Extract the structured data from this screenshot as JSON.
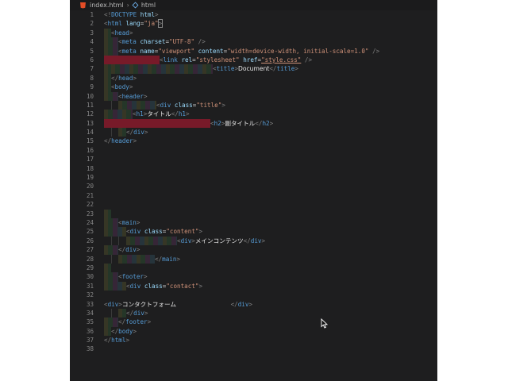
{
  "breadcrumb": {
    "file": "index.html",
    "symbol": "html"
  },
  "lines": [
    {
      "n": "1",
      "guides": [],
      "tok": [
        [
          "b",
          "<!"
        ],
        [
          "t",
          "DOCTYPE"
        ],
        [
          "a",
          " html"
        ],
        [
          "b",
          ">"
        ]
      ]
    },
    {
      "n": "2",
      "guides": [],
      "tok": [
        [
          "b",
          "<"
        ],
        [
          "t",
          "html"
        ],
        [
          "a",
          " lang"
        ],
        [
          "p",
          "="
        ],
        [
          "s",
          "\"ja\""
        ],
        [
          "b",
          ">"
        ]
      ]
    },
    {
      "n": "3",
      "guides": [],
      "tok": [
        [
          "b",
          "<"
        ],
        [
          "t",
          "head"
        ],
        [
          "b",
          ">"
        ]
      ]
    },
    {
      "n": "4",
      "guides": [],
      "tok": [
        [
          "b",
          "<"
        ],
        [
          "t",
          "meta"
        ],
        [
          "a",
          " charset"
        ],
        [
          "p",
          "="
        ],
        [
          "s",
          "\"UTF-8\""
        ],
        [
          "b",
          " />"
        ]
      ]
    },
    {
      "n": "5",
      "guides": [],
      "tok": [
        [
          "b",
          "<"
        ],
        [
          "t",
          "meta"
        ],
        [
          "a",
          " name"
        ],
        [
          "p",
          "="
        ],
        [
          "s",
          "\"viewport\""
        ],
        [
          "a",
          " content"
        ],
        [
          "p",
          "="
        ],
        [
          "s",
          "\"width=device-width, initial-scale=1.0\""
        ],
        [
          "b",
          " />"
        ]
      ]
    },
    {
      "n": "6",
      "guides": [],
      "tok": [
        [
          "b",
          "<"
        ],
        [
          "t",
          "link"
        ],
        [
          "a",
          " rel"
        ],
        [
          "p",
          "="
        ],
        [
          "s",
          "\"stylesheet\""
        ],
        [
          "a",
          " href"
        ],
        [
          "p",
          "="
        ],
        [
          "su",
          "\"style.css\""
        ],
        [
          "b",
          " />"
        ]
      ]
    },
    {
      "n": "7",
      "guides": [],
      "tok": [
        [
          "b",
          "<"
        ],
        [
          "t",
          "title"
        ],
        [
          "b",
          ">"
        ],
        [
          "x",
          "Document"
        ],
        [
          "b",
          "</"
        ],
        [
          "t",
          "title"
        ],
        [
          "b",
          ">"
        ]
      ]
    },
    {
      "n": "8",
      "guides": [],
      "tok": [
        [
          "b",
          "</"
        ],
        [
          "t",
          "head"
        ],
        [
          "b",
          ">"
        ]
      ]
    },
    {
      "n": "9",
      "guides": [],
      "tok": [
        [
          "b",
          "<"
        ],
        [
          "t",
          "body"
        ],
        [
          "b",
          ">"
        ]
      ]
    },
    {
      "n": "10",
      "guides": [],
      "tok": [
        [
          "b",
          "<"
        ],
        [
          "t",
          "header"
        ],
        [
          "b",
          ">"
        ]
      ]
    },
    {
      "n": "11",
      "guides": [],
      "tok": [
        [
          "b",
          "<"
        ],
        [
          "t",
          "div"
        ],
        [
          "a",
          " class"
        ],
        [
          "p",
          "="
        ],
        [
          "s",
          "\"title\""
        ],
        [
          "b",
          ">"
        ]
      ]
    },
    {
      "n": "12",
      "guides": [],
      "tok": [
        [
          "b",
          "<"
        ],
        [
          "t",
          "h1"
        ],
        [
          "b",
          ">"
        ],
        [
          "x",
          "タイトル"
        ],
        [
          "b",
          "</"
        ],
        [
          "t",
          "h1"
        ],
        [
          "b",
          ">"
        ]
      ]
    },
    {
      "n": "13",
      "guides": [],
      "tok": [
        [
          "b",
          "<"
        ],
        [
          "t",
          "h2"
        ],
        [
          "b",
          ">"
        ],
        [
          "x",
          "副タイトル"
        ],
        [
          "b",
          "</"
        ],
        [
          "t",
          "h2"
        ],
        [
          "b",
          ">"
        ]
      ]
    },
    {
      "n": "14",
      "guides": [],
      "tok": [
        [
          "b",
          "</"
        ],
        [
          "t",
          "div"
        ],
        [
          "b",
          ">"
        ]
      ]
    },
    {
      "n": "15",
      "guides": [],
      "tok": [
        [
          "b",
          "</"
        ],
        [
          "t",
          "header"
        ],
        [
          "b",
          ">"
        ]
      ]
    },
    {
      "n": "16",
      "guides": [],
      "tok": []
    },
    {
      "n": "17",
      "guides": [],
      "tok": []
    },
    {
      "n": "18",
      "guides": [],
      "tok": []
    },
    {
      "n": "19",
      "guides": [],
      "tok": []
    },
    {
      "n": "20",
      "guides": [],
      "tok": []
    },
    {
      "n": "21",
      "guides": [],
      "tok": []
    },
    {
      "n": "22",
      "guides": [],
      "tok": []
    },
    {
      "n": "23",
      "guides": [],
      "tok": []
    },
    {
      "n": "24",
      "guides": [],
      "tok": [
        [
          "b",
          "<"
        ],
        [
          "t",
          "main"
        ],
        [
          "b",
          ">"
        ]
      ]
    },
    {
      "n": "25",
      "guides": [],
      "tok": [
        [
          "b",
          "<"
        ],
        [
          "t",
          "div"
        ],
        [
          "a",
          " class"
        ],
        [
          "p",
          "="
        ],
        [
          "s",
          "\"content\""
        ],
        [
          "b",
          ">"
        ]
      ]
    },
    {
      "n": "26",
      "guides": [],
      "tok": [
        [
          "b",
          "<"
        ],
        [
          "t",
          "div"
        ],
        [
          "b",
          ">"
        ],
        [
          "x",
          "メインコンテンツ"
        ],
        [
          "b",
          "</"
        ],
        [
          "t",
          "div"
        ],
        [
          "b",
          ">"
        ]
      ]
    },
    {
      "n": "27",
      "guides": [],
      "tok": [
        [
          "b",
          "</"
        ],
        [
          "t",
          "div"
        ],
        [
          "b",
          ">"
        ]
      ]
    },
    {
      "n": "28",
      "guides": [],
      "tok": [
        [
          "b",
          "</"
        ],
        [
          "t",
          "main"
        ],
        [
          "b",
          ">"
        ]
      ]
    },
    {
      "n": "29",
      "guides": [],
      "tok": []
    },
    {
      "n": "30",
      "guides": [],
      "tok": [
        [
          "b",
          "<"
        ],
        [
          "t",
          "footer"
        ],
        [
          "b",
          ">"
        ]
      ]
    },
    {
      "n": "31",
      "guides": [],
      "tok": [
        [
          "b",
          "<"
        ],
        [
          "t",
          "div"
        ],
        [
          "a",
          " class"
        ],
        [
          "p",
          "="
        ],
        [
          "s",
          "\"contact\""
        ],
        [
          "b",
          ">"
        ]
      ]
    },
    {
      "n": "32",
      "guides": [],
      "tok": []
    },
    {
      "n": "33",
      "guides": [],
      "tok": [
        [
          "b",
          "<"
        ],
        [
          "t",
          "div"
        ],
        [
          "b",
          ">"
        ],
        [
          "x",
          "コンタクトフォーム"
        ],
        [
          "p",
          "               "
        ],
        [
          "b",
          "</"
        ],
        [
          "t",
          "div"
        ],
        [
          "b",
          ">"
        ]
      ]
    },
    {
      "n": "34",
      "guides": [],
      "tok": [
        [
          "b",
          "</"
        ],
        [
          "t",
          "div"
        ],
        [
          "b",
          ">"
        ]
      ]
    },
    {
      "n": "35",
      "guides": [],
      "tok": [
        [
          "b",
          "</"
        ],
        [
          "t",
          "footer"
        ],
        [
          "b",
          ">"
        ]
      ]
    },
    {
      "n": "36",
      "guides": [],
      "tok": [
        [
          "b",
          "</"
        ],
        [
          "t",
          "body"
        ],
        [
          "b",
          ">"
        ]
      ]
    },
    {
      "n": "37",
      "guides": [],
      "tok": [
        [
          "b",
          "</"
        ],
        [
          "t",
          "html"
        ],
        [
          "b",
          ">"
        ]
      ]
    },
    {
      "n": "38",
      "guides": [],
      "tok": []
    }
  ],
  "colors": {
    "editor_bg": "#1e1e1f",
    "line_number": "#858585",
    "tag": "#569cd6",
    "attribute": "#9cdcfe",
    "string": "#ce9178",
    "bracket": "#808080",
    "text": "#e8e8e8",
    "error_indent": "#961a2d"
  },
  "icons": {
    "file": "html5-icon",
    "symbol": "cube-icon",
    "pointer": "mouse-pointer-icon"
  }
}
